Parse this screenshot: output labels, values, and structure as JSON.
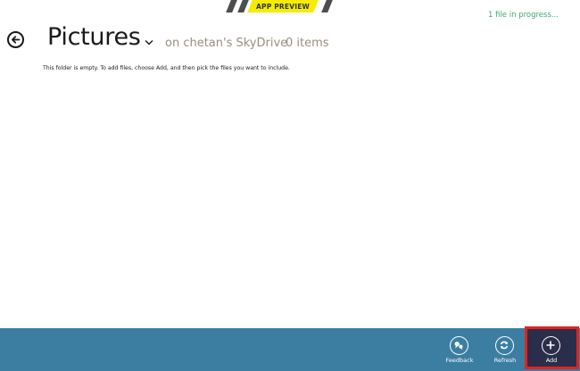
{
  "banner": {
    "label": "APP PREVIEW"
  },
  "status": {
    "progress_text": "1 file in progress..."
  },
  "header": {
    "title": "Pictures",
    "location": "on chetan's SkyDrive",
    "item_count": "0 items"
  },
  "main": {
    "empty_message": "This folder is empty. To add files, choose Add, and then pick the files you want to include."
  },
  "app_bar": {
    "background_color": "#3b7ea1",
    "highlight_color": "#e3231b",
    "buttons": [
      {
        "label": "Feedback",
        "icon": "feedback-icon"
      },
      {
        "label": "Refresh",
        "icon": "refresh-icon"
      },
      {
        "label": "Add",
        "icon": "add-icon"
      }
    ]
  },
  "colors": {
    "accent_green": "#3aa876",
    "subtitle_gray": "#9a8e80",
    "banner_yellow": "#f6ec00"
  }
}
